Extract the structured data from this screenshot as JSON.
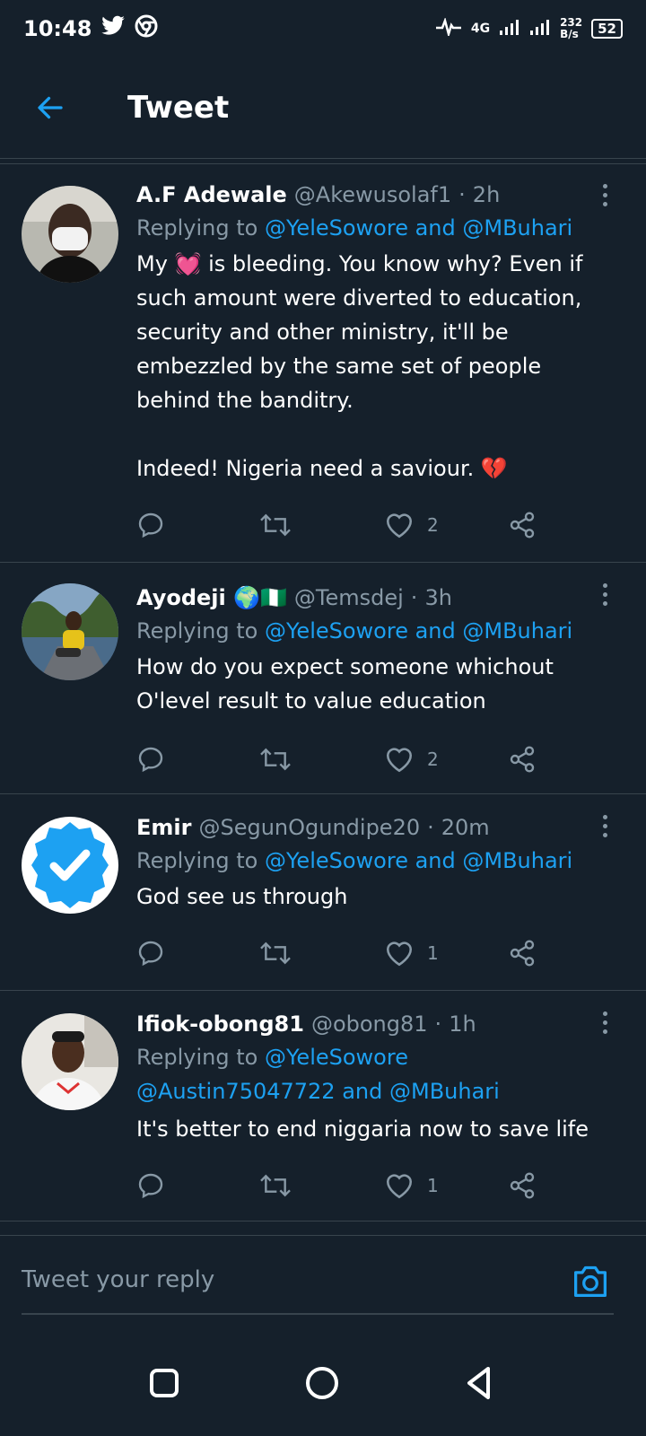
{
  "status": {
    "time": "10:48",
    "network": "4G",
    "speed": "232",
    "speed_unit": "B/s",
    "battery": "52"
  },
  "header": {
    "title": "Tweet"
  },
  "tweets": [
    {
      "name": "A.F Adewale",
      "handle": "@Akewusolaf1",
      "time": "2h",
      "replying_prefix": "Replying to",
      "mentions": "@YeleSowore and @MBuhari",
      "text_before_heart": "My ",
      "text_after_heart": " is bleeding. You know why? Even if such amount were diverted to education, security and other ministry, it'll be embezzled by the same set of people behind the banditry.",
      "text_last": "Indeed! Nigeria need a saviour. ",
      "likes": "2"
    },
    {
      "name": "Ayodeji 🌍🇳🇬",
      "handle": "@Temsdej",
      "time": "3h",
      "replying_prefix": "Replying to",
      "mentions": "@YeleSowore and @MBuhari",
      "text": "How do you expect someone whichout O'level result to value education",
      "likes": "2"
    },
    {
      "name": "Emir",
      "handle": "@SegunOgundipe20",
      "time": "20m",
      "replying_prefix": "Replying to",
      "mentions": "@YeleSowore and @MBuhari",
      "text": "God see us through",
      "likes": "1"
    },
    {
      "name": "Ifiok-obong81",
      "handle": "@obong81",
      "time": "1h",
      "replying_prefix": "Replying to",
      "mentions_line1": "@YeleSowore",
      "mentions_line2": "@Austin75047722 and @MBuhari",
      "text": "It's better to end niggaria now to save life",
      "likes": "1"
    }
  ],
  "reply": {
    "placeholder": "Tweet your reply"
  },
  "colors": {
    "background": "#15202b",
    "accent": "#1da1f2",
    "muted": "#8899a6",
    "divider": "#38444d"
  }
}
